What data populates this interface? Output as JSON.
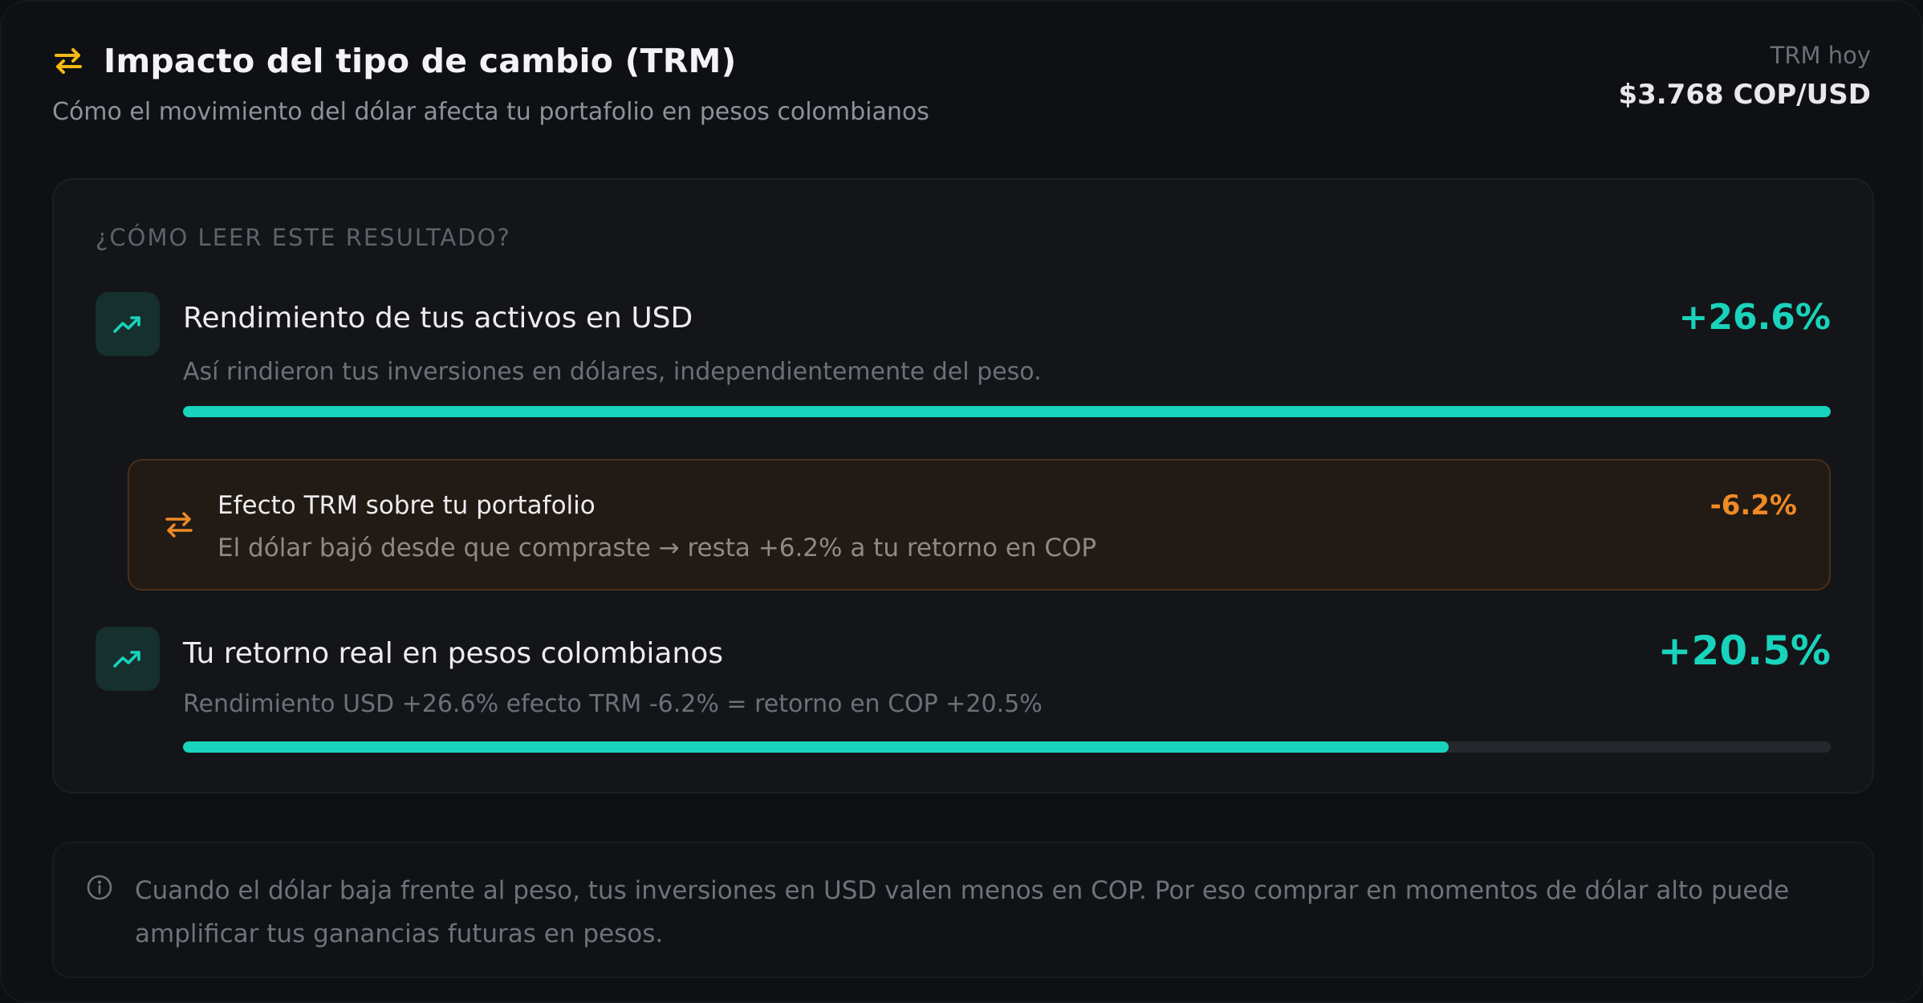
{
  "header": {
    "icon": "swap-arrows-icon",
    "title": "Impacto del tipo de cambio (TRM)",
    "subtitle": "Cómo el movimiento del dólar afecta tu portafolio en pesos colombianos",
    "trm_label": "TRM hoy",
    "trm_value": "$3.768 COP/USD"
  },
  "card": {
    "heading": "¿CÓMO LEER ESTE RESULTADO?",
    "usd_return": {
      "icon": "trending-up-icon",
      "title": "Rendimiento de tus activos en USD",
      "value": "+26.6%",
      "description": "Así rindieron tus inversiones en dólares, independientemente del peso.",
      "progress": 1.0
    },
    "trm_effect": {
      "icon": "swap-arrows-icon",
      "title": "Efecto TRM sobre tu portafolio",
      "description": "El dólar bajó desde que compraste → resta +6.2% a tu retorno en COP",
      "value": "-6.2%"
    },
    "cop_return": {
      "icon": "trending-up-icon",
      "title": "Tu retorno real en pesos colombianos",
      "value": "+20.5%",
      "description": "Rendimiento USD +26.6% efecto TRM -6.2% = retorno en COP +20.5%",
      "progress": 0.768
    }
  },
  "note": {
    "icon": "info-icon",
    "text": "Cuando el dólar baja frente al peso, tus inversiones en USD valen menos en COP. Por eso comprar en momentos de dólar alto puede amplificar tus ganancias futuras en pesos."
  },
  "colors": {
    "accent_teal": "#19d3bc",
    "accent_orange": "#f08a26",
    "title_icon_yellow": "#f5b814"
  }
}
